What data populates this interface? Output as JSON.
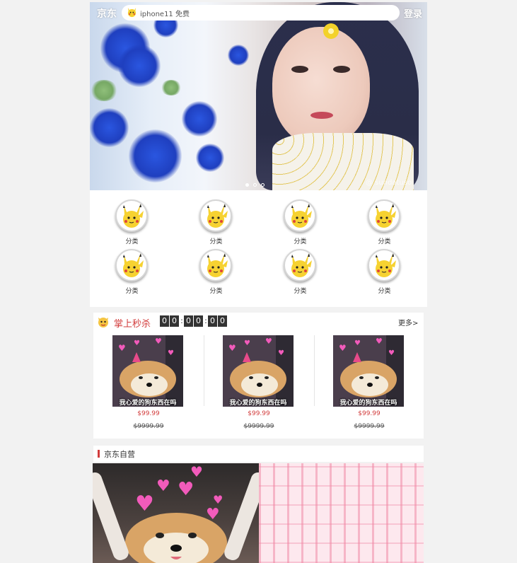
{
  "header": {
    "logo": "京东",
    "search_placeholder": "iphone11 免费",
    "login": "登录"
  },
  "banner": {
    "watermark": "@ sundatuso",
    "slides": 3,
    "active_slide": 1
  },
  "categories": [
    {
      "label": "分类",
      "icon": "pikachu-icon"
    },
    {
      "label": "分类",
      "icon": "pikachu-icon"
    },
    {
      "label": "分类",
      "icon": "pikachu-icon"
    },
    {
      "label": "分类",
      "icon": "pikachu-icon"
    },
    {
      "label": "分类",
      "icon": "pikachu-icon"
    },
    {
      "label": "分类",
      "icon": "pikachu-icon"
    },
    {
      "label": "分类",
      "icon": "pikachu-icon"
    },
    {
      "label": "分类",
      "icon": "pikachu-icon"
    }
  ],
  "seckill": {
    "title": "掌上秒杀",
    "timer": [
      "0",
      "0",
      "0",
      "0",
      "0",
      "0"
    ],
    "more": "更多>",
    "items": [
      {
        "caption": "我心爱的狗东西在吗",
        "price": "$99.99",
        "old_price": "$9999.99"
      },
      {
        "caption": "我心爱的狗东西在吗",
        "price": "$99.99",
        "old_price": "$9999.99"
      },
      {
        "caption": "我心爱的狗东西在吗",
        "price": "$99.99",
        "old_price": "$9999.99"
      }
    ]
  },
  "self_run": {
    "title": "京东自营"
  },
  "colors": {
    "accent": "#d23c3c",
    "background": "#f2f2f2"
  }
}
